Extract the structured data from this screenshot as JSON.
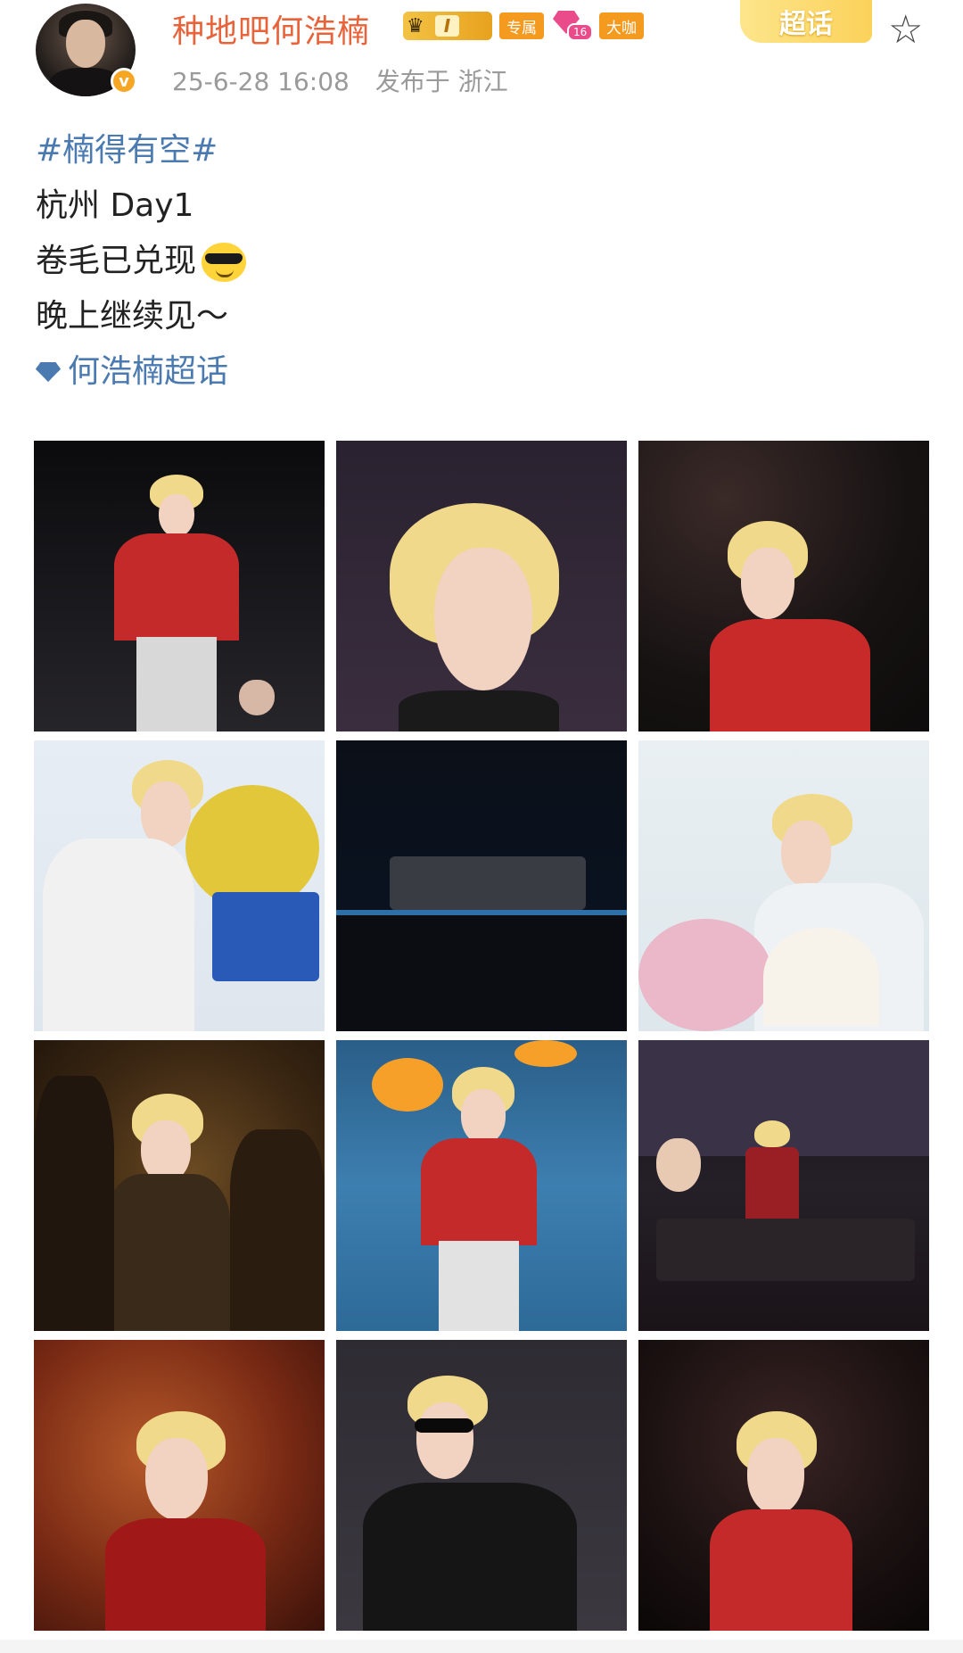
{
  "post": {
    "username": "种地吧何浩楠",
    "badges": {
      "level_text": "I",
      "tag_exclusive": "专属",
      "tag_fans_level": "16",
      "tag_vip": "大咖"
    },
    "supertopic_button": "超话",
    "timestamp": "25-6-28 16:08",
    "location": "发布于 浙江",
    "hashtag": "#楠得有空#",
    "lines": [
      "杭州 Day1",
      "卷毛已兑现",
      "晚上继续见～"
    ],
    "supertopic_link": "何浩楠超话"
  },
  "colors": {
    "username": "#e8633a",
    "link": "#4a7ab0",
    "meta": "#9a9a9a"
  },
  "photos": [
    {
      "name": "photo-1",
      "desc": "stage-red-outfit"
    },
    {
      "name": "photo-2",
      "desc": "closeup-blonde"
    },
    {
      "name": "photo-3",
      "desc": "stage-curly-red"
    },
    {
      "name": "photo-4",
      "desc": "white-suit-flowers"
    },
    {
      "name": "photo-5",
      "desc": "stage-bow-group"
    },
    {
      "name": "photo-6",
      "desc": "fan-flowers"
    },
    {
      "name": "photo-7",
      "desc": "backstage-group"
    },
    {
      "name": "photo-8",
      "desc": "red-outfit-flowers"
    },
    {
      "name": "photo-9",
      "desc": "stage-dancers"
    },
    {
      "name": "photo-10",
      "desc": "red-suit-portrait"
    },
    {
      "name": "photo-11",
      "desc": "sunglasses-black-jacket"
    },
    {
      "name": "photo-12",
      "desc": "curly-red-portrait"
    }
  ]
}
